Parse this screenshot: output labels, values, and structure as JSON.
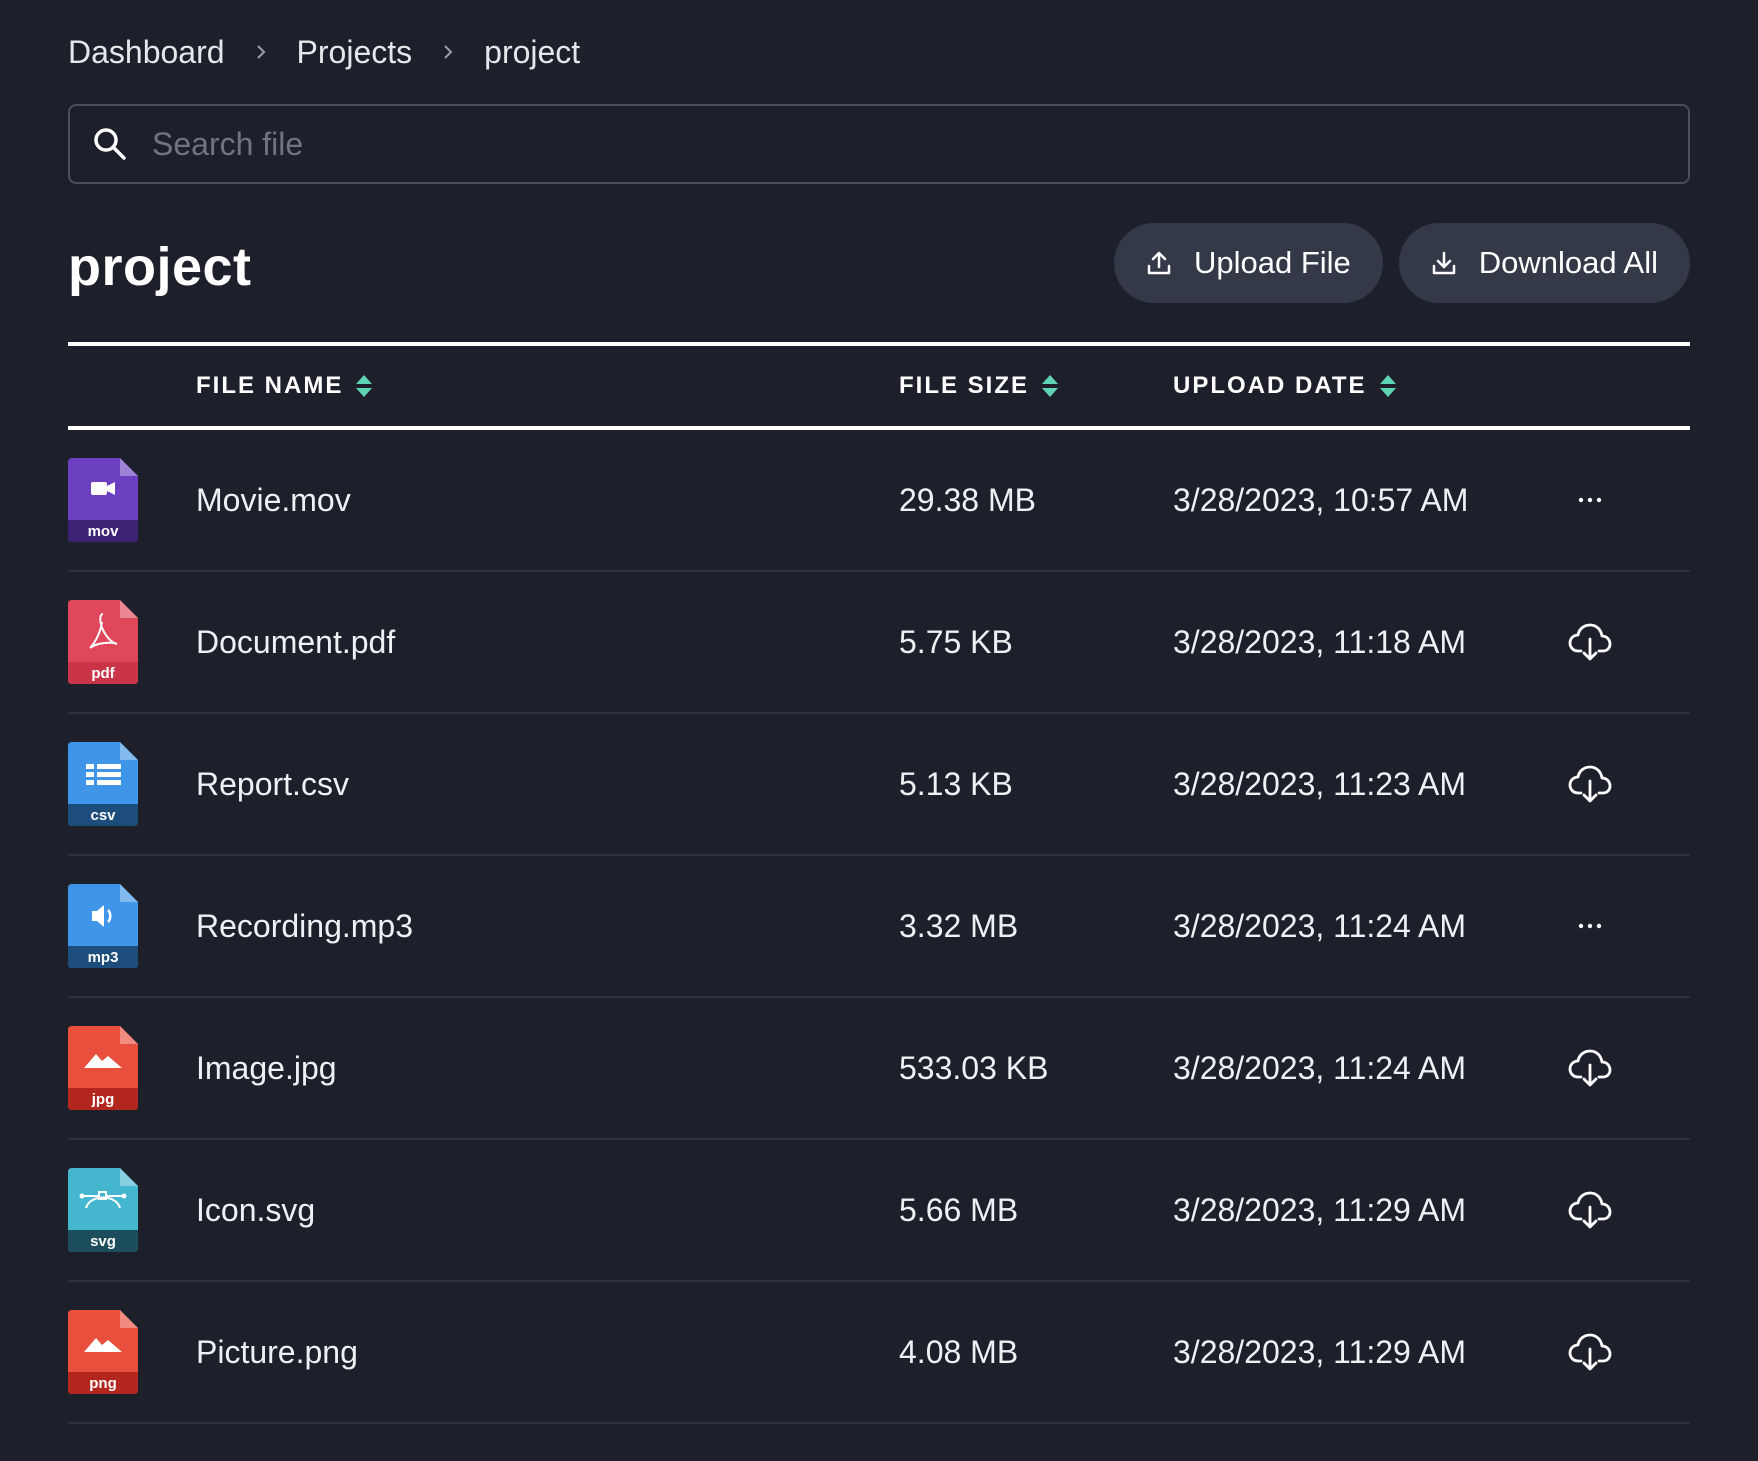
{
  "breadcrumb": {
    "items": [
      "Dashboard",
      "Projects",
      "project"
    ]
  },
  "search": {
    "placeholder": "Search file",
    "value": ""
  },
  "header": {
    "title": "project",
    "upload_label": "Upload File",
    "download_label": "Download All"
  },
  "table": {
    "columns": {
      "name": "FILE NAME",
      "size": "FILE SIZE",
      "date": "UPLOAD DATE"
    },
    "rows": [
      {
        "name": "Movie.mov",
        "size": "29.38 MB",
        "date": "3/28/2023, 10:57 AM",
        "ext": "mov",
        "icon": "video-file-icon",
        "color": "#6b3fc0",
        "band": "#3d2275",
        "action": "more-options-icon"
      },
      {
        "name": "Document.pdf",
        "size": "5.75 KB",
        "date": "3/28/2023, 11:18 AM",
        "ext": "pdf",
        "icon": "pdf-file-icon",
        "color": "#e0475a",
        "band": "#c93448",
        "action": "cloud-download-icon"
      },
      {
        "name": "Report.csv",
        "size": "5.13 KB",
        "date": "3/28/2023, 11:23 AM",
        "ext": "csv",
        "icon": "csv-file-icon",
        "color": "#3f95e8",
        "band": "#1d4d7a",
        "action": "cloud-download-icon"
      },
      {
        "name": "Recording.mp3",
        "size": "3.32 MB",
        "date": "3/28/2023, 11:24 AM",
        "ext": "mp3",
        "icon": "audio-file-icon",
        "color": "#3f95e8",
        "band": "#1d4d7a",
        "action": "more-options-icon"
      },
      {
        "name": "Image.jpg",
        "size": "533.03 KB",
        "date": "3/28/2023, 11:24 AM",
        "ext": "jpg",
        "icon": "image-file-icon",
        "color": "#e84f3d",
        "band": "#b3261e",
        "action": "cloud-download-icon"
      },
      {
        "name": "Icon.svg",
        "size": "5.66 MB",
        "date": "3/28/2023, 11:29 AM",
        "ext": "svg",
        "icon": "vector-file-icon",
        "color": "#44b7cf",
        "band": "#1c4d5c",
        "action": "cloud-download-icon"
      },
      {
        "name": "Picture.png",
        "size": "4.08 MB",
        "date": "3/28/2023, 11:29 AM",
        "ext": "png",
        "icon": "image-file-icon",
        "color": "#e84f3d",
        "band": "#b3261e",
        "action": "cloud-download-icon"
      }
    ]
  },
  "colors": {
    "background": "#1d202a",
    "button_bg": "#343948",
    "sort_accent": "#5fd4b3"
  }
}
